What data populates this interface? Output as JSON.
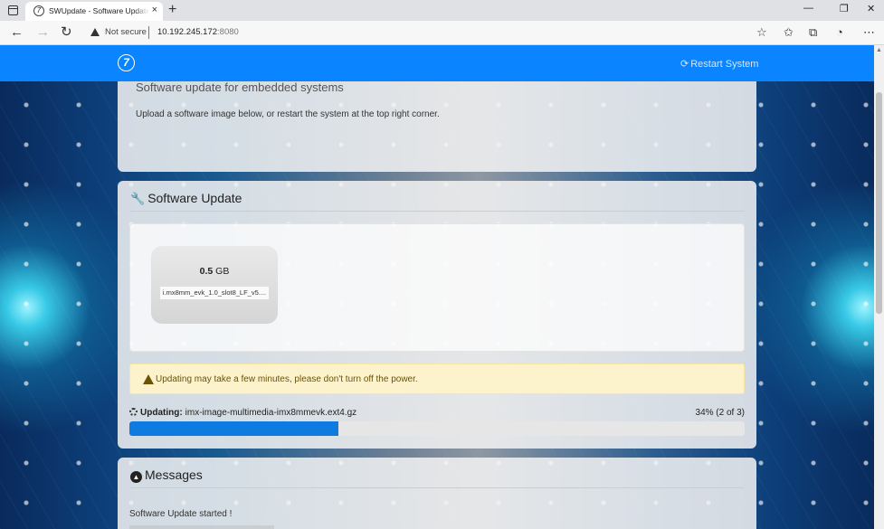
{
  "browser": {
    "tab_title": "SWUpdate - Software Update for",
    "tab_close": "×",
    "new_tab": "+",
    "security_label": "Not secure",
    "url_host": "10.192.245.172",
    "url_port": ":8080"
  },
  "header": {
    "restart_label": "Restart System"
  },
  "intro": {
    "tagline": "Software update for embedded systems",
    "description": "Upload a software image below, or restart the system at the top right corner."
  },
  "update": {
    "title": "Software Update",
    "file_size_value": "0.5",
    "file_size_unit": "GB",
    "file_name": "i.mx8mm_evk_1.0_slot8_LF_v5....",
    "warning": "Updating may take a few minutes, please don't turn off the power.",
    "status_label": "Updating:",
    "status_file": "imx-image-multimedia-imx8mmevk.ext4.gz",
    "progress_text": "34% (2 of 3)",
    "progress_percent": 34
  },
  "messages": {
    "title": "Messages",
    "first_line": "Software Update started !"
  }
}
